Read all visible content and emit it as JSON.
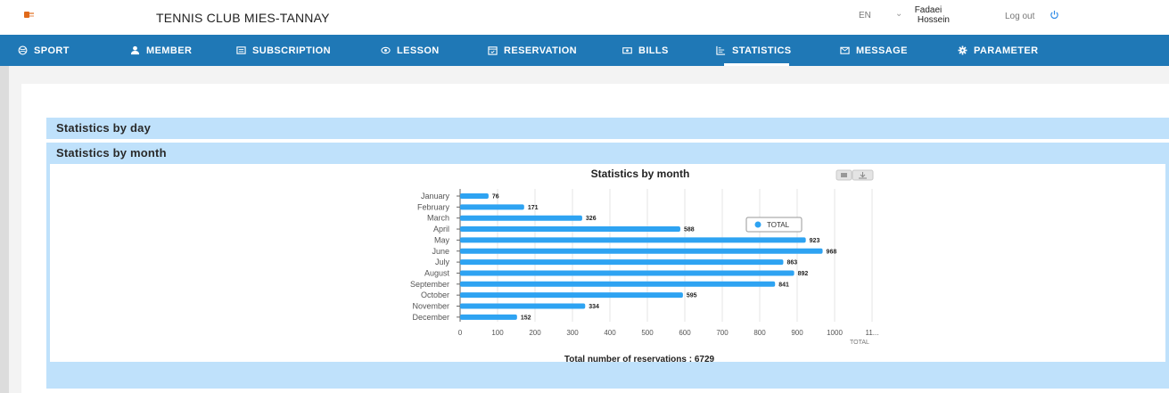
{
  "header": {
    "club_name": "TENNIS CLUB MIES-TANNAY",
    "language": "EN",
    "user_name_line1": "Fadaei",
    "user_name_line2": "Hossein",
    "logout_label": "Log out"
  },
  "nav": {
    "items": [
      {
        "label": "SPORT",
        "icon": "sport-icon"
      },
      {
        "label": "MEMBER",
        "icon": "member-icon"
      },
      {
        "label": "SUBSCRIPTION",
        "icon": "subscription-icon"
      },
      {
        "label": "LESSON",
        "icon": "lesson-icon"
      },
      {
        "label": "RESERVATION",
        "icon": "calendar-icon"
      },
      {
        "label": "BILLS",
        "icon": "bills-icon"
      },
      {
        "label": "STATISTICS",
        "icon": "statistics-icon"
      },
      {
        "label": "MESSAGE",
        "icon": "mail-icon"
      },
      {
        "label": "PARAMETER",
        "icon": "gear-icon"
      }
    ],
    "active": "STATISTICS"
  },
  "sections": {
    "by_day": "Statistics by day",
    "by_month": "Statistics by month"
  },
  "colors": {
    "nav_bg": "#1f78b6",
    "section_bg": "#bfe1fb",
    "bar": "#2ea3f2"
  },
  "chart_data": {
    "type": "bar",
    "orientation": "horizontal",
    "title": "Statistics by month",
    "categories": [
      "January",
      "February",
      "March",
      "April",
      "May",
      "June",
      "July",
      "August",
      "September",
      "October",
      "November",
      "December"
    ],
    "series": [
      {
        "name": "TOTAL",
        "values": [
          76,
          171,
          326,
          588,
          923,
          968,
          863,
          892,
          841,
          595,
          334,
          152
        ]
      }
    ],
    "xlim": [
      0,
      1100
    ],
    "x_ticks": [
      "0",
      "100",
      "200",
      "300",
      "400",
      "500",
      "600",
      "700",
      "800",
      "900",
      "1000",
      "11..."
    ],
    "xlabel": "TOTAL",
    "grid": true,
    "legend": "TOTAL",
    "total_text": "Total number of reservations : 6729"
  }
}
